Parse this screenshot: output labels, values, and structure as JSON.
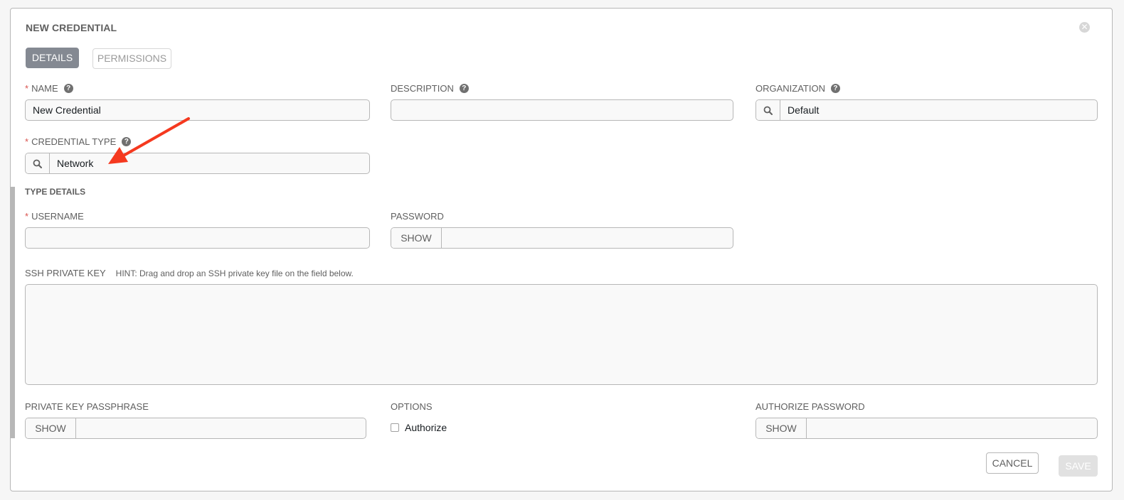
{
  "panel": {
    "title": "NEW CREDENTIAL",
    "close_icon": "close-circle-icon"
  },
  "tabs": [
    {
      "label": "DETAILS",
      "active": true
    },
    {
      "label": "PERMISSIONS",
      "active": false
    }
  ],
  "fields": {
    "name": {
      "label": "NAME",
      "required": true,
      "value": "New Credential",
      "help_icon": "question-circle-icon"
    },
    "description": {
      "label": "DESCRIPTION",
      "required": false,
      "value": "",
      "help_icon": "question-circle-icon"
    },
    "organization": {
      "label": "ORGANIZATION",
      "required": false,
      "value": "Default",
      "help_icon": "question-circle-icon",
      "lookup_icon": "search-icon"
    },
    "credential_type": {
      "label": "CREDENTIAL TYPE",
      "required": true,
      "value": "Network",
      "help_icon": "question-circle-icon",
      "lookup_icon": "search-icon"
    }
  },
  "type_details": {
    "title": "TYPE DETAILS",
    "username": {
      "label": "USERNAME",
      "required": true,
      "value": ""
    },
    "password": {
      "label": "PASSWORD",
      "show_label": "SHOW",
      "value": ""
    },
    "ssh_private_key": {
      "label": "SSH PRIVATE KEY",
      "hint": "HINT: Drag and drop an SSH private key file on the field below.",
      "value": ""
    },
    "private_key_passphrase": {
      "label": "PRIVATE KEY PASSPHRASE",
      "show_label": "SHOW",
      "value": ""
    },
    "options": {
      "label": "OPTIONS",
      "authorize_label": "Authorize",
      "authorize_checked": false
    },
    "authorize_password": {
      "label": "AUTHORIZE PASSWORD",
      "show_label": "SHOW",
      "value": ""
    }
  },
  "actions": {
    "cancel_label": "CANCEL",
    "save_label": "SAVE",
    "save_enabled": false
  },
  "colors": {
    "required": "#d9534f",
    "annotation_arrow": "#f5391f",
    "active_tab": "#848992"
  },
  "annotation": {
    "type": "arrow",
    "points_to": "credential_type"
  }
}
